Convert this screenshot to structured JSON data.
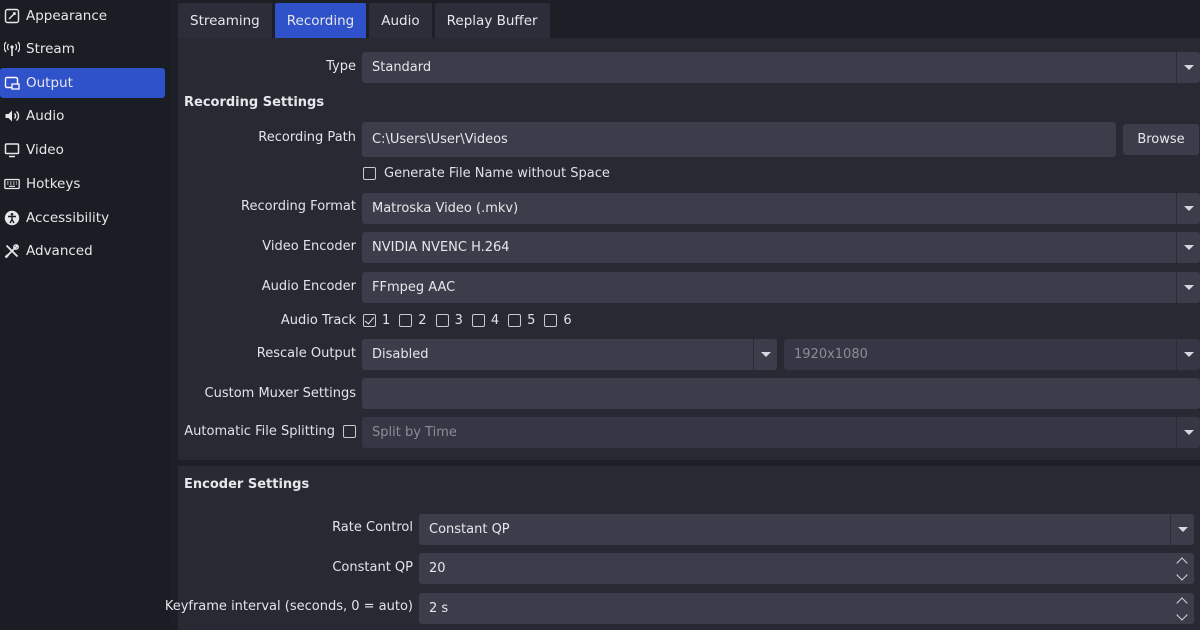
{
  "sidebar": {
    "items": [
      {
        "label": "Appearance",
        "icon": "appearance-icon",
        "active": false
      },
      {
        "label": "Stream",
        "icon": "antenna-icon",
        "active": false
      },
      {
        "label": "Output",
        "icon": "output-icon",
        "active": true
      },
      {
        "label": "Audio",
        "icon": "speaker-icon",
        "active": false
      },
      {
        "label": "Video",
        "icon": "monitor-icon",
        "active": false
      },
      {
        "label": "Hotkeys",
        "icon": "keyboard-icon",
        "active": false
      },
      {
        "label": "Accessibility",
        "icon": "accessibility-icon",
        "active": false
      },
      {
        "label": "Advanced",
        "icon": "tools-icon",
        "active": false
      }
    ]
  },
  "tabs": [
    {
      "label": "Streaming",
      "active": false
    },
    {
      "label": "Recording",
      "active": true
    },
    {
      "label": "Audio",
      "active": false
    },
    {
      "label": "Replay Buffer",
      "active": false
    }
  ],
  "type": {
    "label": "Type",
    "value": "Standard"
  },
  "recording_settings": {
    "title": "Recording Settings",
    "path": {
      "label": "Recording Path",
      "value": "C:\\Users\\User\\Videos",
      "browse": "Browse"
    },
    "no_space": {
      "label": "Generate File Name without Space",
      "checked": false
    },
    "format": {
      "label": "Recording Format",
      "value": "Matroska Video (.mkv)"
    },
    "video_encoder": {
      "label": "Video Encoder",
      "value": "NVIDIA NVENC H.264"
    },
    "audio_encoder": {
      "label": "Audio Encoder",
      "value": "FFmpeg AAC"
    },
    "audio_track": {
      "label": "Audio Track",
      "tracks": [
        {
          "label": "1",
          "checked": true
        },
        {
          "label": "2",
          "checked": false
        },
        {
          "label": "3",
          "checked": false
        },
        {
          "label": "4",
          "checked": false
        },
        {
          "label": "5",
          "checked": false
        },
        {
          "label": "6",
          "checked": false
        }
      ]
    },
    "rescale": {
      "label": "Rescale Output",
      "value": "Disabled",
      "resolution": "1920x1080"
    },
    "muxer": {
      "label": "Custom Muxer Settings",
      "value": ""
    },
    "splitting": {
      "label": "Automatic File Splitting",
      "checked": false,
      "value": "Split by Time"
    }
  },
  "encoder_settings": {
    "title": "Encoder Settings",
    "rate_control": {
      "label": "Rate Control",
      "value": "Constant QP"
    },
    "cqp": {
      "label": "Constant QP",
      "value": "20"
    },
    "keyframe": {
      "label": "Keyframe interval (seconds, 0 = auto)",
      "value": "2 s"
    }
  },
  "colors": {
    "accent": "#2f51c9",
    "background": "#1d1f26",
    "panel": "#272a33",
    "field": "#3b3e4a"
  }
}
